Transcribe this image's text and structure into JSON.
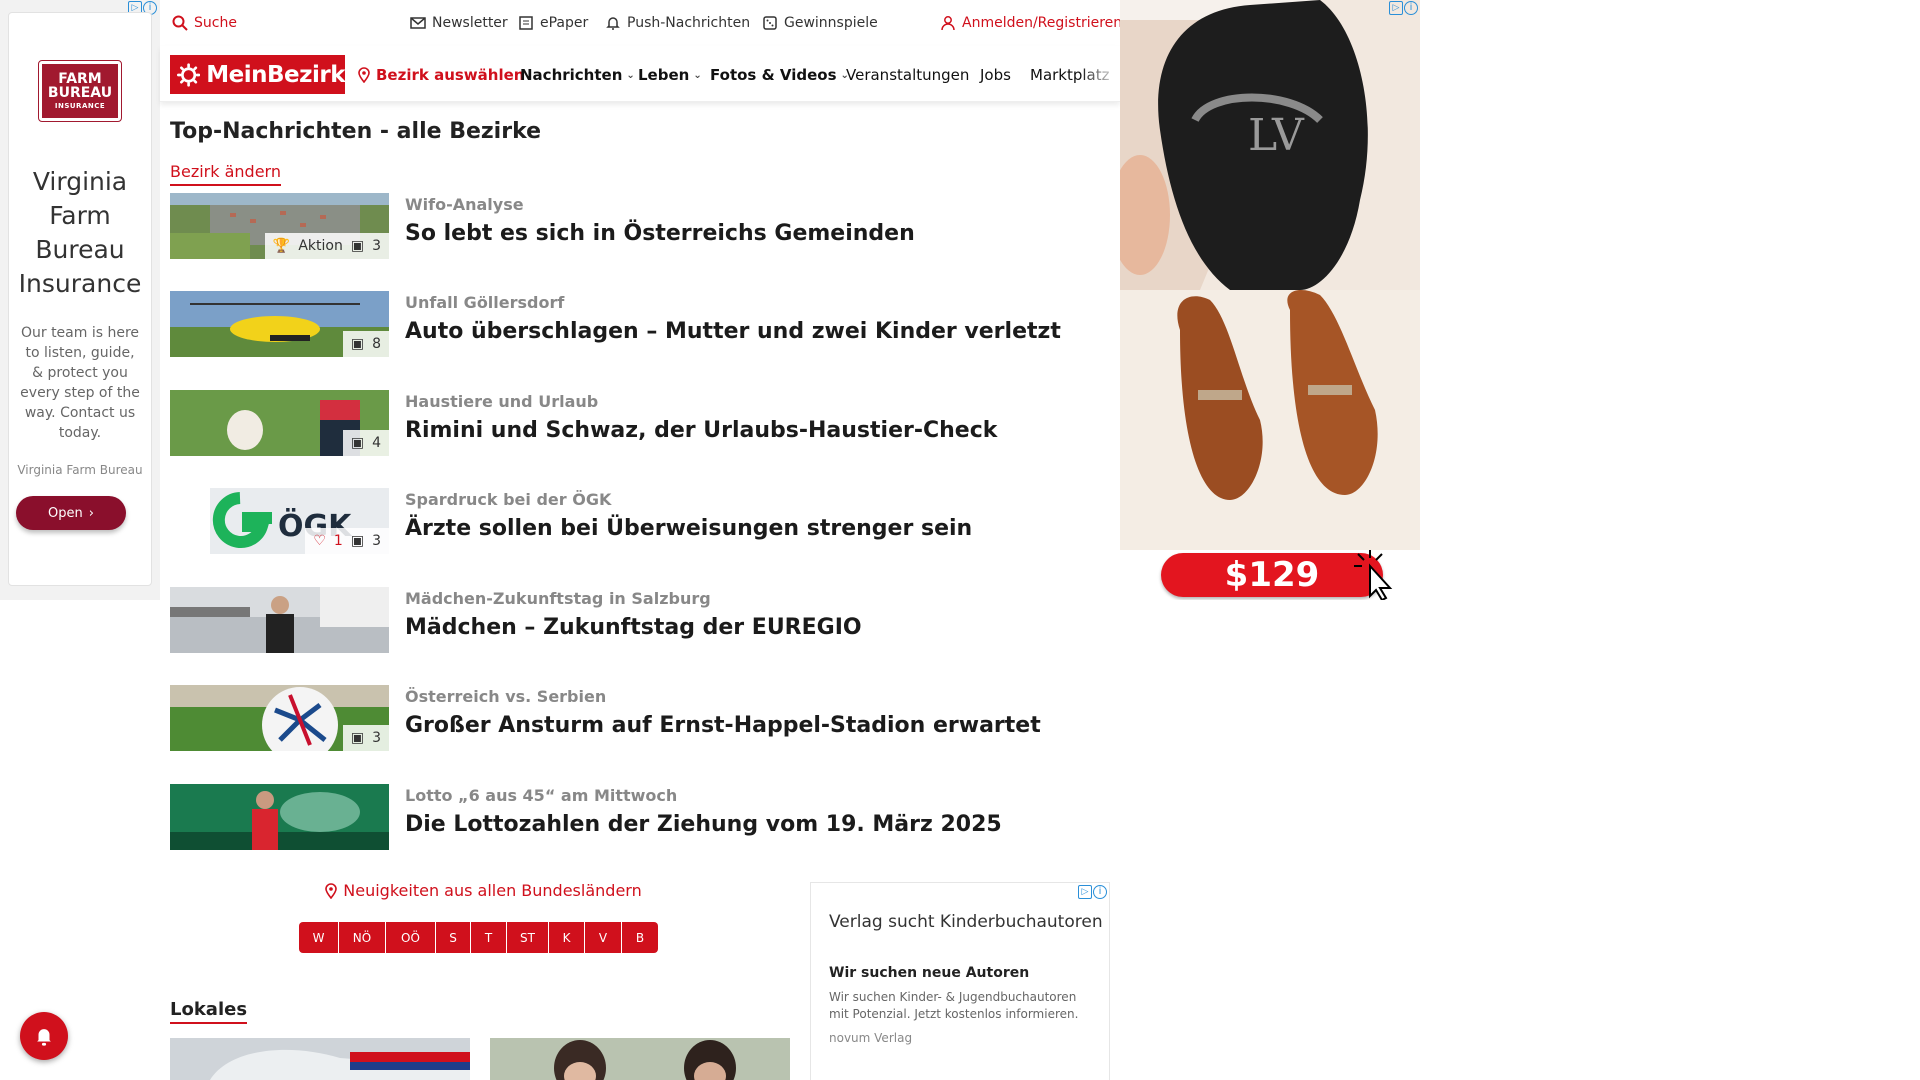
{
  "topbar": {
    "search_label": "Suche",
    "newsletter_label": "Newsletter",
    "epaper_label": "ePaper",
    "push_label": "Push-Nachrichten",
    "gewinnspiele_label": "Gewinnspiele",
    "login_label": "Anmelden/Registrieren"
  },
  "nav": {
    "logo_text": "MeinBezirk",
    "district_label": "Bezirk auswählen",
    "items": [
      {
        "label": "Nachrichten"
      },
      {
        "label": "Leben"
      },
      {
        "label": "Fotos & Videos"
      },
      {
        "label": "Veranstaltungen"
      },
      {
        "label": "Jobs"
      },
      {
        "label": "Marktplatz"
      }
    ]
  },
  "page": {
    "title": "Top-Nachrichten - alle Bezirke",
    "change_district": "Bezirk ändern"
  },
  "articles": [
    {
      "kicker": "Wifo-Analyse",
      "headline": "So lebt es sich in Österreichs Gemeinden",
      "badge_action": "Aktion",
      "photo_count": "3"
    },
    {
      "kicker": "Unfall Göllersdorf",
      "headline": "Auto überschlagen – Mutter und zwei Kinder verletzt",
      "photo_count": "8"
    },
    {
      "kicker": "Haustiere und Urlaub",
      "headline": "Rimini und Schwaz, der Urlaubs-Haustier-Check",
      "photo_count": "4"
    },
    {
      "kicker": "Spardruck bei der ÖGK",
      "headline": "Ärzte sollen bei Überweisungen strenger sein",
      "like_count": "1",
      "photo_count": "3"
    },
    {
      "kicker": "Mädchen-Zukunftstag in Salzburg",
      "headline": "Mädchen – Zukunftstag der EUREGIO"
    },
    {
      "kicker": "Österreich vs. Serbien",
      "headline": "Großer Ansturm auf Ernst-Happel-Stadion erwartet",
      "photo_count": "3"
    },
    {
      "kicker": "Lotto „6 aus 45“ am Mittwoch",
      "headline": "Die Lottozahlen der Ziehung vom 19. März 2025"
    }
  ],
  "states": {
    "title": "Neuigkeiten aus allen Bundesländern",
    "items": [
      "W",
      "NÖ",
      "OÖ",
      "S",
      "T",
      "ST",
      "K",
      "V",
      "B"
    ]
  },
  "lokales_title": "Lokales",
  "ad_left": {
    "logo_line1": "FARM",
    "logo_line2": "BUREAU",
    "logo_line3": "INSURANCE",
    "headline": "Virginia Farm Bureau Insurance",
    "body": "Our team is here to listen, guide, & protect you every step of the way. Contact us today.",
    "brand": "Virginia Farm Bureau",
    "button": "Open"
  },
  "ad_right": {
    "price": "$129"
  },
  "ad_mid": {
    "title": "Verlag sucht Kinderbuchautoren",
    "subtitle": "Wir suchen neue Autoren",
    "description": "Wir suchen Kinder- & Jugendbuchautoren mit Potenzial. Jetzt kostenlos informieren.",
    "brand": "novum Verlag"
  },
  "colors": {
    "brand_red": "#d0101c",
    "ad_maroon": "#8a0f2c"
  }
}
